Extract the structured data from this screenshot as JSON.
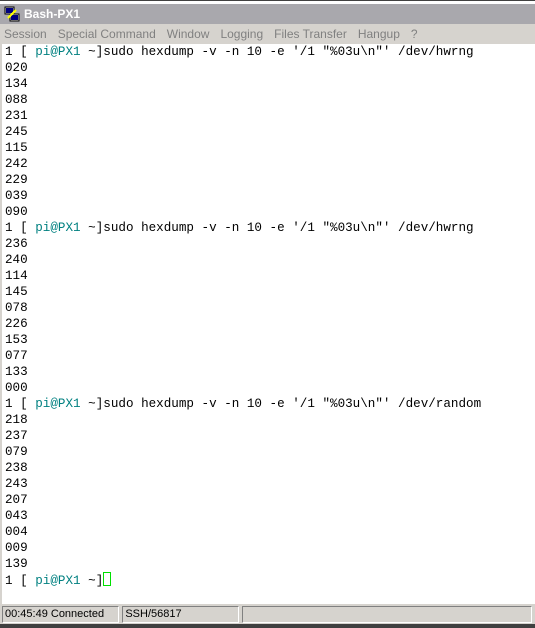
{
  "window": {
    "title": "Bash-PX1",
    "icon": "putty-terminal-icon"
  },
  "menu": [
    "Session",
    "Special Command",
    "Window",
    "Logging",
    "Files Transfer",
    "Hangup",
    "?"
  ],
  "terminal": {
    "prompt_prefix": "1 [ ",
    "prompt_user": "pi@PX1",
    "prompt_suffix": " ~]",
    "blocks": [
      {
        "command": "sudo hexdump -v -n 10 -e '/1 \"%03u\\n\"' /dev/hwrng",
        "output": [
          "020",
          "134",
          "088",
          "231",
          "245",
          "115",
          "242",
          "229",
          "039",
          "090"
        ]
      },
      {
        "command": "sudo hexdump -v -n 10 -e '/1 \"%03u\\n\"' /dev/hwrng",
        "output": [
          "236",
          "240",
          "114",
          "145",
          "078",
          "226",
          "153",
          "077",
          "133",
          "000"
        ]
      },
      {
        "command": "sudo hexdump -v -n 10 -e '/1 \"%03u\\n\"' /dev/random",
        "output": [
          "218",
          "237",
          "079",
          "238",
          "243",
          "207",
          "043",
          "004",
          "009",
          "139"
        ]
      }
    ],
    "current_input": ""
  },
  "status": {
    "connection": "00:45:49 Connected",
    "protocol": "SSH/56817",
    "extra": ""
  },
  "colors": {
    "prompt_user": "#008080",
    "cursor": "#00e000",
    "titlebar": "#a9a8ad",
    "chrome": "#d6d3ce"
  }
}
